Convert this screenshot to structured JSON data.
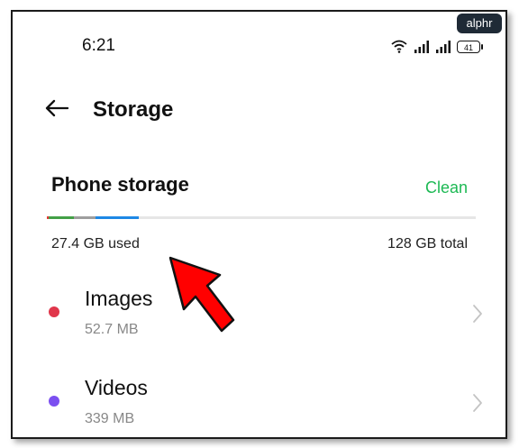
{
  "watermark": "alphr",
  "status_bar": {
    "time": "6:21",
    "battery": "41",
    "icons": [
      "wifi-icon",
      "signal-icon",
      "signal-icon",
      "battery-icon"
    ]
  },
  "header": {
    "back_icon": "arrow-left-icon",
    "title": "Storage"
  },
  "phone_storage": {
    "title": "Phone storage",
    "clean_label": "Clean",
    "used": "27.4 GB used",
    "total": "128 GB total",
    "bar_segments": [
      {
        "color": "#e53935",
        "fraction": 0.004
      },
      {
        "color": "#43a047",
        "fraction": 0.06
      },
      {
        "color": "#9e9e9e",
        "fraction": 0.05
      },
      {
        "color": "#1e88e5",
        "fraction": 0.1
      }
    ]
  },
  "categories": [
    {
      "label": "Images",
      "size": "52.7 MB",
      "color": "#e0364b"
    },
    {
      "label": "Videos",
      "size": "339 MB",
      "color": "#7b4ff0"
    }
  ],
  "colors": {
    "accent": "#1db954",
    "annotation_arrow": "#ff0000"
  }
}
